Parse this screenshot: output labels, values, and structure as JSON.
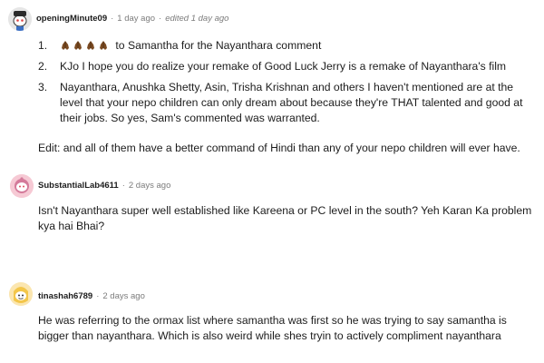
{
  "comments": [
    {
      "username": "openingMinute09",
      "time": "1 day ago",
      "edited": "edited 1 day ago",
      "avatar_icon": "snoo-avatar-icon",
      "points": [
        {
          "num": "1.",
          "emojis": [
            "folded-hands-icon",
            "folded-hands-icon",
            "folded-hands-icon",
            "folded-hands-icon"
          ],
          "text": "to Samantha for the Nayanthara comment"
        },
        {
          "num": "2.",
          "text": "KJo I hope you do realize your remake of Good Luck Jerry is a remake of Nayanthara's film"
        },
        {
          "num": "3.",
          "text": "Nayanthara, Anushka Shetty, Asin, Trisha Krishnan and others I haven't mentioned are at the level that your nepo children can only dream about because they're THAT talented and good at their jobs. So yes, Sam's commented was warranted."
        }
      ],
      "edit_note": "Edit: and all of them have a better command of Hindi than any of your nepo children will ever have."
    },
    {
      "username": "SubstantialLab4611",
      "time": "2 days ago",
      "avatar_icon": "snoo-avatar-icon",
      "text": "Isn't Nayanthara super well established like Kareena or PC level in the south? Yeh Karan Ka problem kya hai Bhai?"
    },
    {
      "username": "tinashah6789",
      "time": "2 days ago",
      "avatar_icon": "snoo-avatar-icon",
      "text": "He was referring to the ormax list where samantha was first so he was trying to say samantha is bigger than nayanthara. Which is also weird while shes tryin to actively compliment nayanthara"
    }
  ],
  "colors": {
    "meta_text": "#7c7c7c",
    "body_text": "#1c1c1c",
    "emoji_brown": "#7a4a22",
    "avatar1_bg": "#e6e6e6",
    "avatar2_bg": "#f6c9d4",
    "avatar3_bg": "#fbe6b0"
  }
}
